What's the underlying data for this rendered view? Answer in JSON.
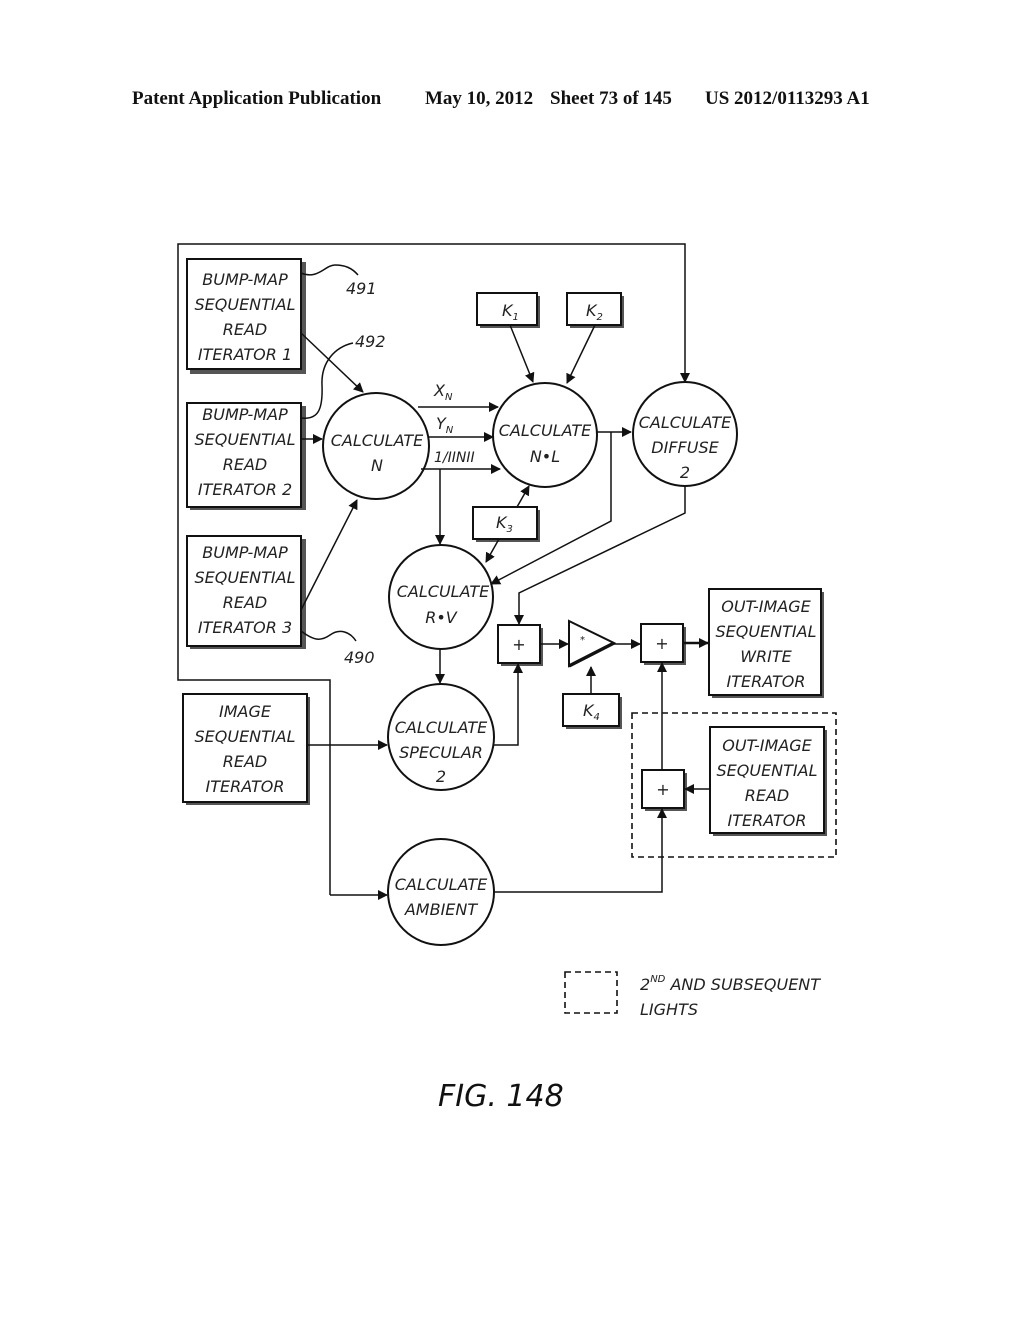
{
  "header": {
    "publication": "Patent Application Publication",
    "date": "May 10, 2012",
    "sheet": "Sheet 73 of 145",
    "number": "US 2012/0113293 A1"
  },
  "figure": {
    "caption": "FIG. 148",
    "iterators": {
      "bump1": [
        "BUMP-MAP",
        "SEQUENTIAL",
        "READ",
        "ITERATOR 1"
      ],
      "bump2": [
        "BUMP-MAP",
        "SEQUENTIAL",
        "READ",
        "ITERATOR 2"
      ],
      "bump3": [
        "BUMP-MAP",
        "SEQUENTIAL",
        "READ",
        "ITERATOR 3"
      ],
      "image_read": [
        "IMAGE",
        "SEQUENTIAL",
        "READ",
        "ITERATOR"
      ],
      "out_write": [
        "OUT-IMAGE",
        "SEQUENTIAL",
        "WRITE",
        "ITERATOR"
      ],
      "out_read": [
        "OUT-IMAGE",
        "SEQUENTIAL",
        "READ",
        "ITERATOR"
      ]
    },
    "processes": {
      "calc_n": [
        "CALCULATE",
        "N"
      ],
      "calc_nl": [
        "CALCULATE",
        "N•L"
      ],
      "calc_diffuse": [
        "CALCULATE",
        "DIFFUSE",
        "2"
      ],
      "calc_rv": [
        "CALCULATE",
        "R•V"
      ],
      "calc_specular": [
        "CALCULATE",
        "SPECULAR",
        "2"
      ],
      "calc_ambient": [
        "CALCULATE",
        "AMBIENT"
      ]
    },
    "constants": {
      "k1": {
        "base": "K",
        "sub": "1"
      },
      "k2": {
        "base": "K",
        "sub": "2"
      },
      "k3": {
        "base": "K",
        "sub": "3"
      },
      "k4": {
        "base": "K",
        "sub": "4"
      }
    },
    "signals": {
      "xn": {
        "base": "X",
        "sub": "N"
      },
      "yn": {
        "base": "Y",
        "sub": "N"
      },
      "inv_norm": "1/IINII"
    },
    "operators": {
      "add": "+",
      "multiply": "*"
    },
    "reference_numerals": {
      "r491": "491",
      "r492": "492",
      "r490": "490"
    },
    "legend": {
      "line1_prefix": "2",
      "line1_sup": "ND",
      "line1_rest": " AND SUBSEQUENT",
      "line2": "LIGHTS"
    }
  }
}
